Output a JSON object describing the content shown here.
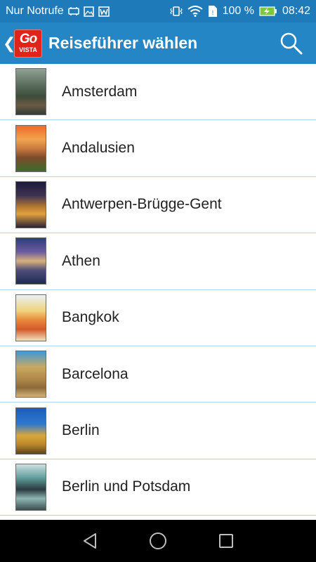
{
  "status_bar": {
    "carrier": "Nur Notrufe",
    "battery": "100 %",
    "time": "08:42",
    "icons": [
      "sim-icon",
      "image-icon",
      "w-app-icon",
      "vibrate-icon",
      "wifi-icon",
      "sim-data-icon",
      "battery-charging-icon"
    ]
  },
  "app_bar": {
    "back_label": "❮",
    "logo_go": "Go",
    "logo_vista": "VISTA",
    "title": "Reiseführer wählen",
    "search_icon": "search-icon"
  },
  "list": {
    "items": [
      {
        "label": "Amsterdam"
      },
      {
        "label": "Andalusien"
      },
      {
        "label": "Antwerpen-Brügge-Gent"
      },
      {
        "label": "Athen"
      },
      {
        "label": "Bangkok"
      },
      {
        "label": "Barcelona"
      },
      {
        "label": "Berlin"
      },
      {
        "label": "Berlin und Potsdam"
      },
      {
        "label": ""
      }
    ]
  },
  "nav_bar": {
    "icons": [
      "back-triangle-icon",
      "home-circle-icon",
      "recents-square-icon"
    ]
  },
  "colors": {
    "status_bar": "#1e7ab8",
    "app_bar": "#2586c6",
    "logo_red": "#e2231a",
    "divider": "#b7d1e2"
  }
}
